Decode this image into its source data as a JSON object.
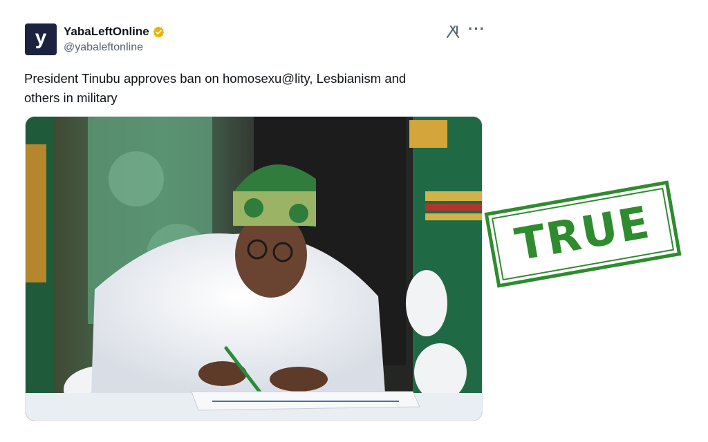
{
  "tweet": {
    "avatar_letter": "y",
    "display_name": "YabaLeftOnline",
    "handle": "@yabaleftonline",
    "verified_badge_color": "#e8b400",
    "text_line_1": "President Tinubu approves ban on homosexu@lity, Lesbianism and",
    "text_line_2": "others in military",
    "media_icon": "grok-icon",
    "more_icon_glyph": "···"
  },
  "stamp": {
    "label": "TRUE",
    "color": "#2e8b2e"
  }
}
